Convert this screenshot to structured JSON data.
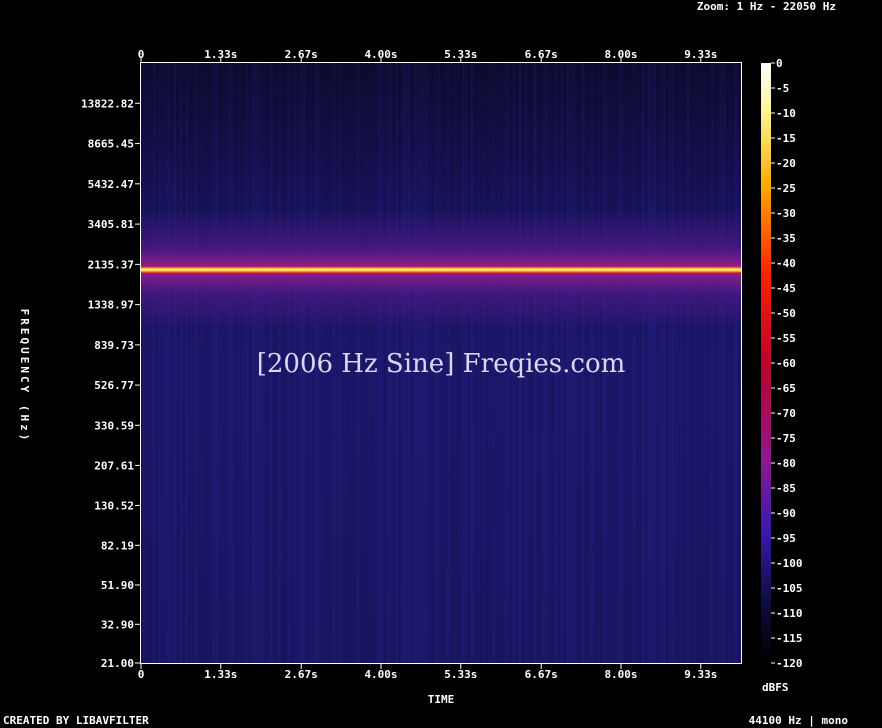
{
  "header": {
    "zoom_text": "Zoom: 1 Hz - 22050 Hz"
  },
  "footer": {
    "creator_text": "CREATED BY LIBAVFILTER",
    "format_text": "44100 Hz | mono"
  },
  "chart_data": {
    "type": "heatmap",
    "title": "[2006 Hz Sine] Freqies.com",
    "xlabel": "TIME",
    "ylabel": "FREQUENCY (Hz)",
    "colorbar_label": "dBFS",
    "x_ticks": [
      "0",
      "1.33s",
      "2.67s",
      "4.00s",
      "5.33s",
      "6.67s",
      "8.00s",
      "9.33s"
    ],
    "x_tick_values": [
      0,
      1.33,
      2.67,
      4.0,
      5.33,
      6.67,
      8.0,
      9.33
    ],
    "xlim": [
      0,
      10
    ],
    "y_ticks": [
      "13822.82",
      "8665.45",
      "5432.47",
      "3405.81",
      "2135.37",
      "1338.97",
      "839.73",
      "526.77",
      "330.59",
      "207.61",
      "130.52",
      "82.19",
      "51.90",
      "32.90",
      "21.00"
    ],
    "y_tick_values": [
      13822.82,
      8665.45,
      5432.47,
      3405.81,
      2135.37,
      1338.97,
      839.73,
      526.77,
      330.59,
      207.61,
      130.52,
      82.19,
      51.9,
      32.9,
      21.0
    ],
    "y_scale": "log",
    "ylim": [
      21.0,
      22050
    ],
    "colorbar_ticks": [
      "0",
      "-5",
      "-10",
      "-15",
      "-20",
      "-25",
      "-30",
      "-35",
      "-40",
      "-45",
      "-50",
      "-55",
      "-60",
      "-65",
      "-70",
      "-75",
      "-80",
      "-85",
      "-90",
      "-95",
      "-100",
      "-105",
      "-110",
      "-115",
      "-120"
    ],
    "colorbar_range": [
      -120,
      0
    ],
    "tone_frequency_hz": 2006,
    "tone_level_dbfs": 0,
    "background_level_dbfs": -100,
    "colors": {
      "background": "#000000",
      "axis": "#ffffff",
      "plot_base": "#1a1766",
      "tone": "#fff2a0"
    }
  }
}
